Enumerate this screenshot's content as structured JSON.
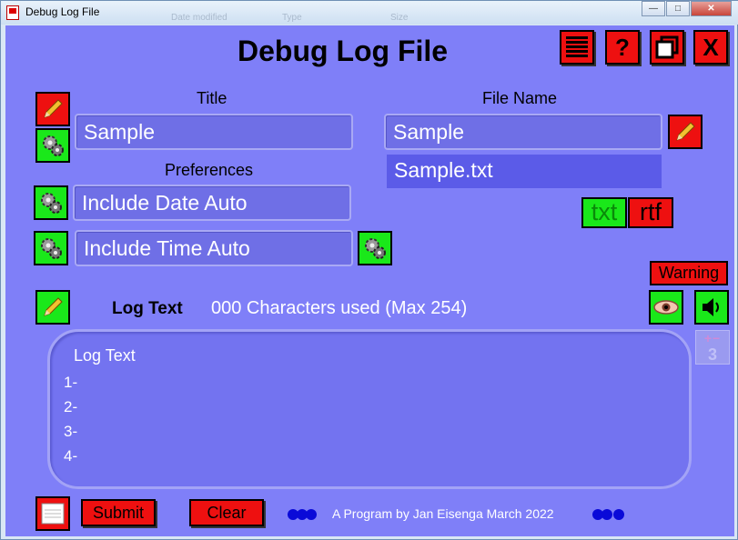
{
  "window": {
    "title": "Debug Log File",
    "ghost_labels": [
      "Date modified",
      "Type",
      "Size"
    ],
    "controls": {
      "minimize": "—",
      "maximize": "□",
      "close": "✕"
    }
  },
  "app": {
    "heading": "Debug Log File",
    "top_buttons": [
      {
        "icon": "list-icon",
        "label": ""
      },
      {
        "icon": "help-icon",
        "label": "?"
      },
      {
        "icon": "restore-icon",
        "label": ""
      },
      {
        "icon": "close-icon",
        "label": "X"
      }
    ]
  },
  "title_section": {
    "label": "Title",
    "value": "Sample"
  },
  "filename_section": {
    "label": "File Name",
    "value": "Sample",
    "full_name": "Sample.txt"
  },
  "preferences": {
    "label": "Preferences",
    "date_option": "Include Date Auto",
    "time_option": "Include Time Auto"
  },
  "format_buttons": {
    "txt": "txt",
    "rtf": "rtf"
  },
  "warning": "Warning",
  "log_text": {
    "label": "Log Text",
    "counter": "000 Characters used (Max 254)",
    "box_title": "Log Text",
    "lines": [
      "1-",
      "2-",
      "3-",
      "4-"
    ]
  },
  "side_counter": {
    "symbols": "+−",
    "value": "3"
  },
  "bottom": {
    "submit": "Submit",
    "clear": "Clear",
    "footer": "A Program by Jan Eisenga March 2022"
  },
  "colors": {
    "background": "#7f7ff8",
    "button_red": "#ee1010",
    "button_green": "#1ae81a",
    "field": "#6f6fe6"
  }
}
